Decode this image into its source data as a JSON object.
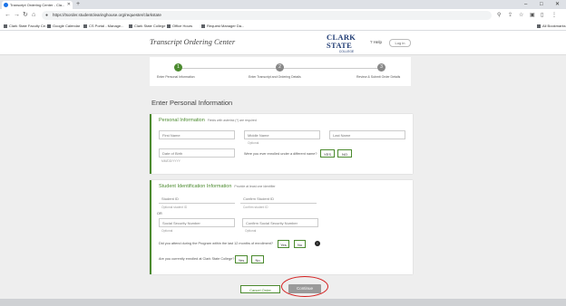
{
  "browser": {
    "tab_title": "Transcript Ordering Center - Cla...",
    "url": "https://tsorder.studentclearinghouse.org/requester/clarkstate",
    "bookmarks": [
      "Clark State Faculty Ce...",
      "Google Calendar",
      "CS Portal - Manage...",
      "Clark State College",
      "Office Hours",
      "Request Manager Da..."
    ],
    "other_bookmarks": "All Bookmarks"
  },
  "header": {
    "title": "Transcript Ordering Center",
    "logo_name": "CLARK STATE",
    "logo_sub": "COLLEGE",
    "help": "Help",
    "account": "Log in"
  },
  "steps": [
    {
      "number": "1",
      "label": "Enter Personal Information"
    },
    {
      "number": "2",
      "label": "Enter Transcript and Ordering Details"
    },
    {
      "number": "3",
      "label": "Review & Submit Order Details"
    }
  ],
  "section_title": "Enter Personal Information",
  "personal": {
    "title": "Personal Information",
    "subtitle": "Fields with asterisk (*) are required",
    "first_name": "First Name",
    "middle_name": "Middle Name",
    "middle_hint": "Optional",
    "last_name": "Last Name",
    "dob": "Date of Birth",
    "dob_hint": "MM/DD/YYYY",
    "other_name_question": "Were you ever enrolled under a different name?",
    "yes": "YES",
    "no": "NO"
  },
  "student_id": {
    "title": "Student Identification Information",
    "subtitle": "Provide at least one identifier",
    "student_id": "Student ID",
    "student_id_hint": "Optional student ID",
    "confirm_student_id": "Confirm Student ID",
    "confirm_student_id_hint": "Confirm student ID",
    "or": "OR",
    "ssn": "Social Security Number",
    "ssn_hint": "Optional",
    "confirm_ssn": "Confirm Social Security Number",
    "confirm_ssn_hint": "Optional",
    "currently_enrolled_question": "Did you attend during the Program within the last 12 months of enrollment?",
    "yes": "Yes",
    "no": "No",
    "info": "i",
    "previous_question": "Are you currently enrolled at Clark State College?",
    "yes2": "Yes",
    "no2": "No"
  },
  "actions": {
    "cancel": "Cancel Order",
    "continue": "Continue"
  },
  "colors": {
    "accent": "#4b8a2e",
    "brand": "#1f3b73",
    "highlight": "#d42020"
  }
}
